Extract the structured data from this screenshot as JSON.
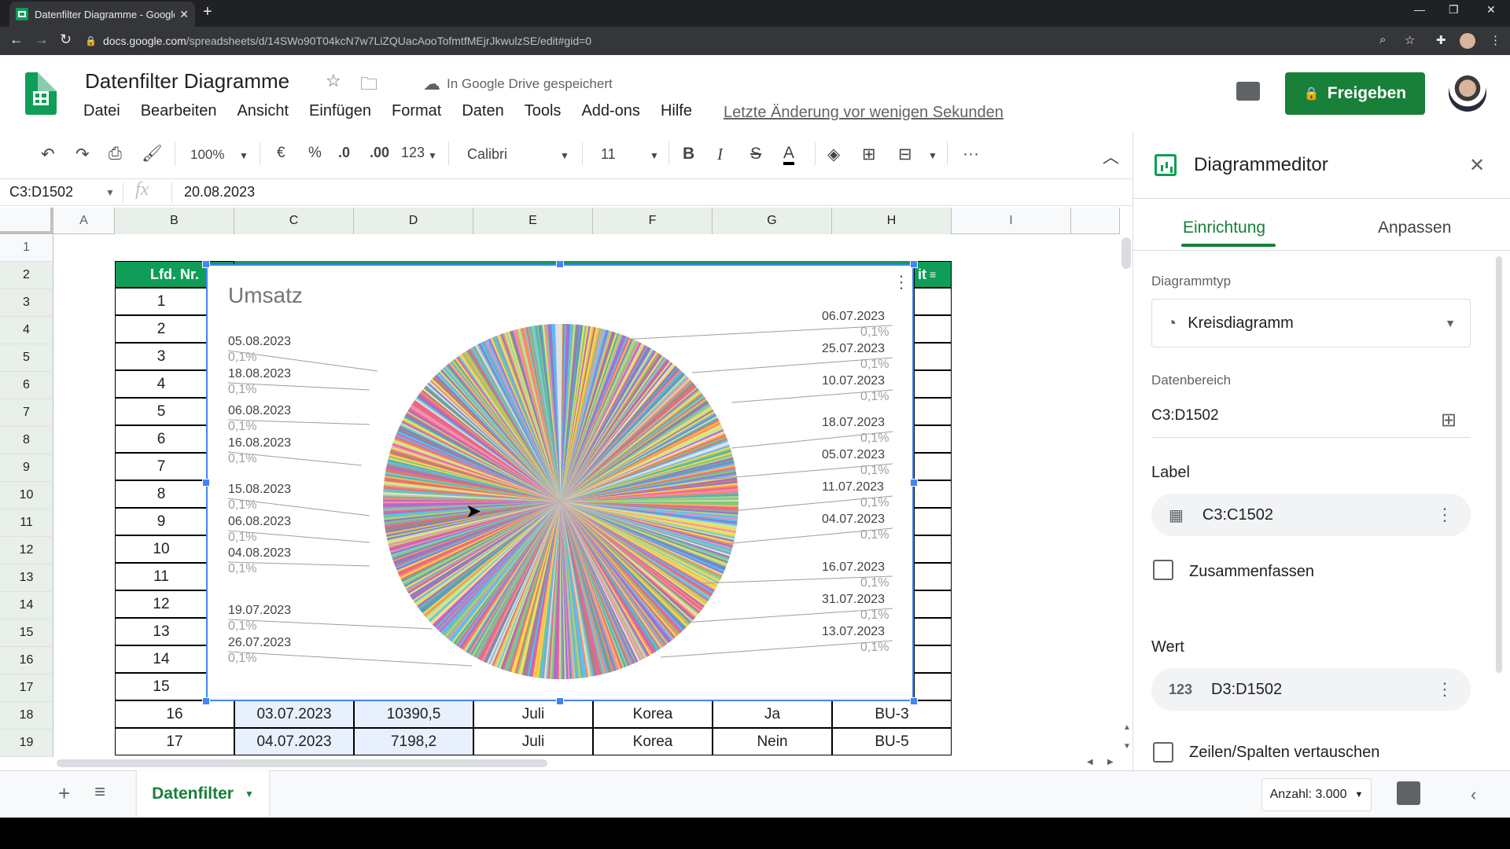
{
  "browser": {
    "tab_title": "Datenfilter Diagramme - Google",
    "url_host": "docs.google.com",
    "url_path": "/spreadsheets/d/14SWo90T04kcN7w7LiZQUacAooTofmtfMEjrJkwulzSE/edit#gid=0"
  },
  "doc": {
    "title": "Datenfilter Diagramme",
    "save_status": "In Google Drive gespeichert",
    "last_edit": "Letzte Änderung vor wenigen Sekunden",
    "share_label": "Freigeben"
  },
  "menu": [
    "Datei",
    "Bearbeiten",
    "Ansicht",
    "Einfügen",
    "Format",
    "Daten",
    "Tools",
    "Add-ons",
    "Hilfe"
  ],
  "toolbar": {
    "zoom": "100%",
    "currency": "€",
    "percent": "%",
    "dec_less": ".0",
    "dec_more": ".00",
    "number_format": "123",
    "font": "Calibri",
    "font_size": "11"
  },
  "formula_bar": {
    "name_box": "C3:D1502",
    "fx": "fx",
    "value": "20.08.2023"
  },
  "columns": [
    "A",
    "B",
    "C",
    "D",
    "E",
    "F",
    "G",
    "H",
    "I"
  ],
  "rows": [
    "1",
    "2",
    "3",
    "4",
    "5",
    "6",
    "7",
    "8",
    "9",
    "10",
    "11",
    "12",
    "13",
    "14",
    "15",
    "16",
    "17",
    "18",
    "19"
  ],
  "table": {
    "header_b": "Lfd. Nr.",
    "header_h_partial": "it",
    "lfd_nr": [
      "1",
      "2",
      "3",
      "4",
      "5",
      "6",
      "7",
      "8",
      "9",
      "10",
      "11",
      "12",
      "13",
      "14",
      "15",
      "16",
      "17"
    ],
    "row18": [
      "16",
      "03.07.2023",
      "10390,5",
      "Juli",
      "Korea",
      "Ja",
      "BU-3"
    ],
    "row19": [
      "17",
      "04.07.2023",
      "7198,2",
      "Juli",
      "Korea",
      "Nein",
      "BU-5"
    ]
  },
  "chart_data": {
    "type": "pie",
    "title": "Umsatz",
    "slice_count": 1500,
    "labels_left": [
      {
        "date": "05.08.2023",
        "pct": "0,1%"
      },
      {
        "date": "18.08.2023",
        "pct": "0,1%"
      },
      {
        "date": "06.08.2023",
        "pct": "0,1%"
      },
      {
        "date": "16.08.2023",
        "pct": "0,1%"
      },
      {
        "date": "15.08.2023",
        "pct": "0,1%"
      },
      {
        "date": "06.08.2023",
        "pct": "0,1%"
      },
      {
        "date": "04.08.2023",
        "pct": "0,1%"
      },
      {
        "date": "19.07.2023",
        "pct": "0,1%"
      },
      {
        "date": "26.07.2023",
        "pct": "0,1%"
      }
    ],
    "labels_right": [
      {
        "date": "06.07.2023",
        "pct": "0,1%"
      },
      {
        "date": "25.07.2023",
        "pct": "0,1%"
      },
      {
        "date": "10.07.2023",
        "pct": "0,1%"
      },
      {
        "date": "18.07.2023",
        "pct": "0,1%"
      },
      {
        "date": "05.07.2023",
        "pct": "0,1%"
      },
      {
        "date": "11.07.2023",
        "pct": "0,1%"
      },
      {
        "date": "04.07.2023",
        "pct": "0,1%"
      },
      {
        "date": "16.07.2023",
        "pct": "0,1%"
      },
      {
        "date": "31.07.2023",
        "pct": "0,1%"
      },
      {
        "date": "13.07.2023",
        "pct": "0,1%"
      }
    ]
  },
  "editor": {
    "title": "Diagrammeditor",
    "tab_setup": "Einrichtung",
    "tab_customize": "Anpassen",
    "chart_type_label": "Diagrammtyp",
    "chart_type_value": "Kreisdiagramm",
    "data_range_label": "Datenbereich",
    "data_range_value": "C3:D1502",
    "label_heading": "Label",
    "label_range": "C3:C1502",
    "aggregate_label": "Zusammenfassen",
    "value_heading": "Wert",
    "value_icon_text": "123",
    "value_range": "D3:D1502",
    "switch_label": "Zeilen/Spalten vertauschen"
  },
  "bottom": {
    "sheet_name": "Datenfilter",
    "count": "Anzahl: 3.000"
  }
}
